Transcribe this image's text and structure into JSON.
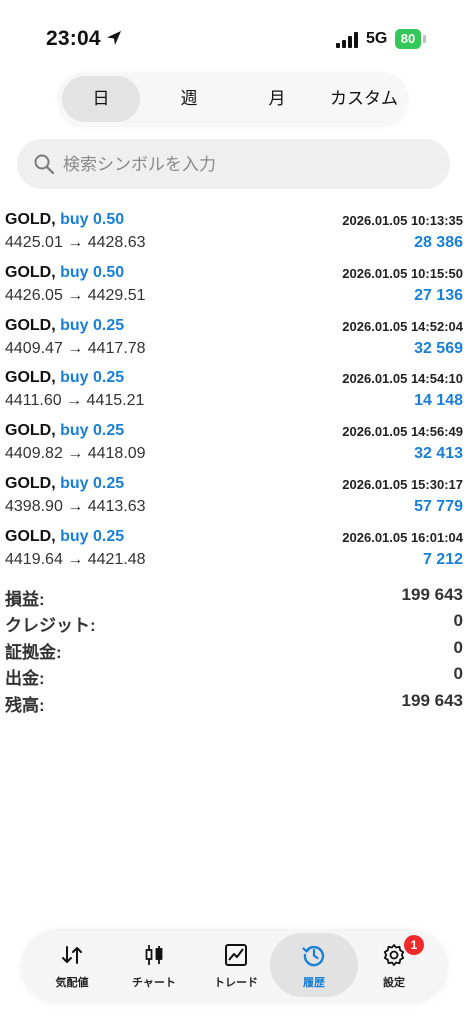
{
  "status_bar": {
    "time": "23:04",
    "network": "5G",
    "battery": "80"
  },
  "tabs": [
    {
      "label": "日",
      "active": true
    },
    {
      "label": "週",
      "active": false
    },
    {
      "label": "月",
      "active": false
    },
    {
      "label": "カスタム",
      "active": false
    }
  ],
  "search": {
    "placeholder": "検索シンボルを入力"
  },
  "trades": [
    {
      "symbol": "GOLD,",
      "side": "buy 0.50",
      "datetime": "2026.01.05 10:13:35",
      "prices": "4425.01 → 4428.63",
      "profit": "28 386"
    },
    {
      "symbol": "GOLD,",
      "side": "buy 0.50",
      "datetime": "2026.01.05 10:15:50",
      "prices": "4426.05 → 4429.51",
      "profit": "27 136"
    },
    {
      "symbol": "GOLD,",
      "side": "buy 0.25",
      "datetime": "2026.01.05 14:52:04",
      "prices": "4409.47 → 4417.78",
      "profit": "32 569"
    },
    {
      "symbol": "GOLD,",
      "side": "buy 0.25",
      "datetime": "2026.01.05 14:54:10",
      "prices": "4411.60 → 4415.21",
      "profit": "14 148"
    },
    {
      "symbol": "GOLD,",
      "side": "buy 0.25",
      "datetime": "2026.01.05 14:56:49",
      "prices": "4409.82 → 4418.09",
      "profit": "32 413"
    },
    {
      "symbol": "GOLD,",
      "side": "buy 0.25",
      "datetime": "2026.01.05 15:30:17",
      "prices": "4398.90 → 4413.63",
      "profit": "57 779"
    },
    {
      "symbol": "GOLD,",
      "side": "buy 0.25",
      "datetime": "2026.01.05 16:01:04",
      "prices": "4419.64 → 4421.48",
      "profit": "7 212"
    }
  ],
  "summary": [
    {
      "label": "損益:",
      "value": "199 643"
    },
    {
      "label": "クレジット:",
      "value": "0"
    },
    {
      "label": "証拠金:",
      "value": "0"
    },
    {
      "label": "出金:",
      "value": "0"
    },
    {
      "label": "残高:",
      "value": "199 643"
    }
  ],
  "nav": [
    {
      "label": "気配値",
      "icon": "quotes-arrows-icon",
      "active": false
    },
    {
      "label": "チャート",
      "icon": "candlestick-chart-icon",
      "active": false
    },
    {
      "label": "トレード",
      "icon": "trade-chart-icon",
      "active": false
    },
    {
      "label": "履歴",
      "icon": "history-clock-icon",
      "active": true
    },
    {
      "label": "設定",
      "icon": "gear-icon",
      "active": false,
      "badge": "1"
    }
  ],
  "colors": {
    "accent": "#1a7fd6",
    "battery": "#34c759",
    "badge": "#ee2a2a"
  }
}
